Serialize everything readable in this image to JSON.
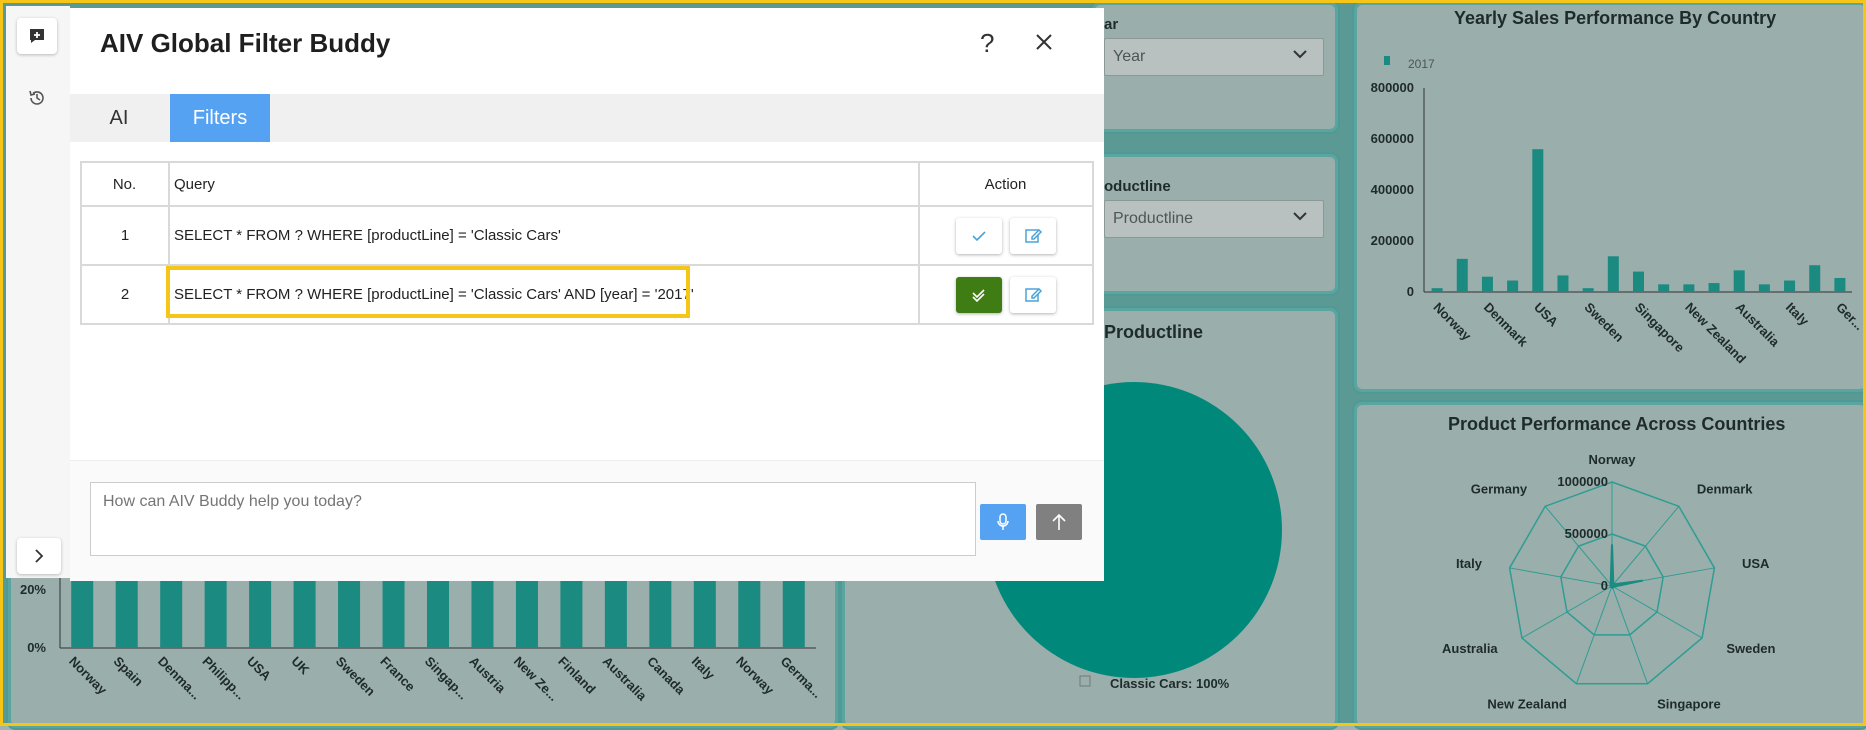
{
  "dialog": {
    "title": "AIV Global Filter Buddy",
    "help_glyph": "?",
    "tabs": [
      {
        "label": "AI"
      },
      {
        "label": "Filters"
      }
    ],
    "table": {
      "headers": {
        "no": "No.",
        "query": "Query",
        "action": "Action"
      },
      "rows": [
        {
          "no": "1",
          "query": "SELECT * FROM ? WHERE [productLine] = 'Classic Cars'"
        },
        {
          "no": "2",
          "query": "SELECT * FROM ? WHERE [productLine] = 'Classic Cars' AND [year] = '2017'"
        }
      ]
    },
    "chat_placeholder": "How can AIV Buddy help you today?"
  },
  "background": {
    "year_filter": {
      "label": "ar",
      "value": "Year"
    },
    "productline_filter": {
      "label": "oductline",
      "value": "Productline"
    },
    "pie_panel_title": "Productline",
    "pie_legend": "Classic Cars: 100%",
    "left_chart_yticks": [
      "20%",
      "0%"
    ],
    "radar_title": "Product Performance Across Countries"
  },
  "chart_data": [
    {
      "type": "bar",
      "title": "Yearly Sales Performance By Country",
      "legend": [
        "2017"
      ],
      "categories": [
        "Norway",
        "",
        "Denmark",
        "",
        "USA",
        "",
        "Sweden",
        "",
        "Singapore",
        "",
        "New Zealand",
        "",
        "Australia",
        "",
        "Italy",
        "",
        "Ger..."
      ],
      "values": [
        15000,
        130000,
        60000,
        45000,
        560000,
        65000,
        15000,
        140000,
        80000,
        30000,
        30000,
        35000,
        85000,
        30000,
        45000,
        105000,
        55000
      ],
      "ylim": [
        0,
        800000
      ],
      "yticks": [
        "800000",
        "600000",
        "400000",
        "200000",
        "0"
      ],
      "color": "#1b8a80"
    },
    {
      "type": "bar",
      "categories": [
        "Norway",
        "Spain",
        "Denma...",
        "Philipp...",
        "USA",
        "UK",
        "Sweden",
        "France",
        "Singap...",
        "Austria",
        "New Ze...",
        "Finland",
        "Australia",
        "Canada",
        "Italy",
        "Norway",
        "Germa..."
      ],
      "color": "#1b8a80"
    },
    {
      "type": "pie",
      "labels": [
        "Classic Cars"
      ],
      "values": [
        100
      ],
      "color": "#00897b"
    },
    {
      "type": "radar",
      "title": "Product Performance Across Countries",
      "axes": [
        "Norway",
        "Denmark",
        "USA",
        "Sweden",
        "Singapore",
        "New Zealand",
        "Australia",
        "Italy",
        "Germany"
      ],
      "ticks": [
        "1000000",
        "500000",
        "0"
      ],
      "values": [
        400000,
        20000,
        300000,
        15000,
        20000,
        10000,
        15000,
        10000,
        20000
      ]
    }
  ]
}
